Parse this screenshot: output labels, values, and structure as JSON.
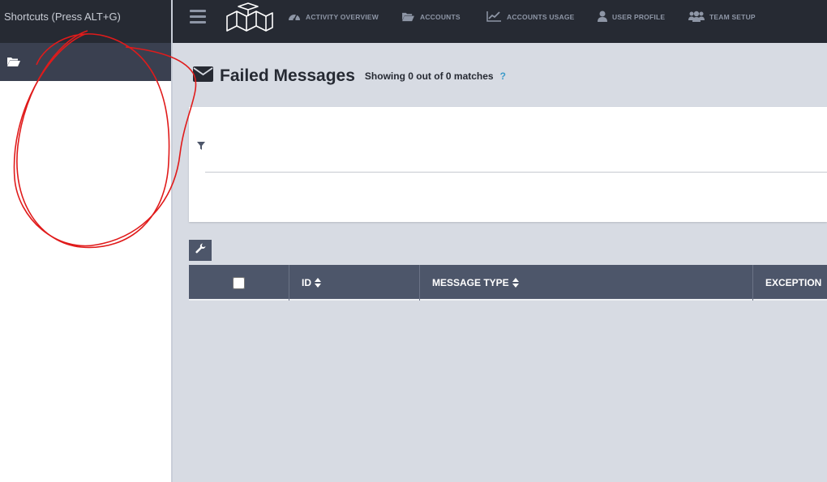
{
  "sidebar": {
    "shortcuts_label": "Shortcuts (Press ALT+G)"
  },
  "nav": {
    "items": [
      {
        "label": "ACTIVITY OVERVIEW",
        "icon": "dashboard-icon"
      },
      {
        "label": "ACCOUNTS",
        "icon": "folder-open-icon"
      },
      {
        "label": "ACCOUNTS USAGE",
        "icon": "line-chart-icon"
      },
      {
        "label": "USER PROFILE",
        "icon": "user-icon"
      },
      {
        "label": "TEAM SETUP",
        "icon": "users-icon"
      }
    ]
  },
  "page": {
    "title": "Failed Messages",
    "match_count": "Showing 0 out of 0 matches",
    "help": "?"
  },
  "table": {
    "columns": [
      {
        "label": "ID"
      },
      {
        "label": "MESSAGE TYPE"
      },
      {
        "label": "EXCEPTION"
      }
    ]
  },
  "annotation": {
    "color": "#e01b1b",
    "shape": "hand-drawn circle"
  }
}
